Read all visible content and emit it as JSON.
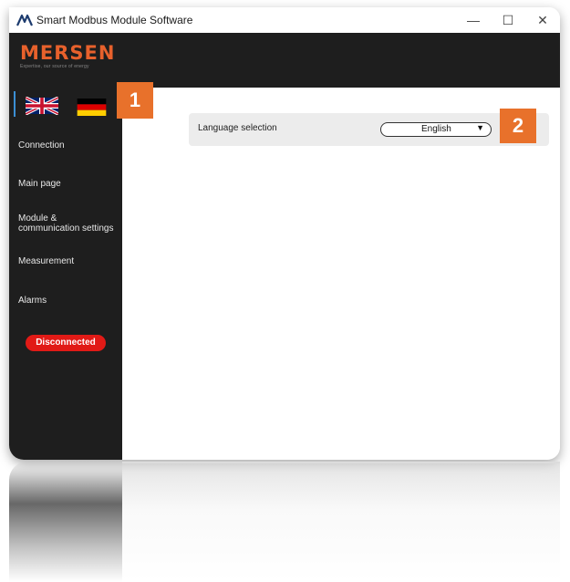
{
  "window": {
    "title": "Smart Modbus Module Software",
    "controls": {
      "minimize": "—",
      "maximize": "☐",
      "close": "✕"
    }
  },
  "brand": {
    "name": "MERSEN",
    "tagline": "Expertise, our source of energy",
    "color": "#e8612c"
  },
  "sidebar": {
    "languages": [
      "English (UK flag)",
      "German (DE flag)"
    ],
    "items": [
      {
        "label": "Connection"
      },
      {
        "label": "Main page"
      },
      {
        "label": "Module & communication settings"
      },
      {
        "label": "Measurement"
      },
      {
        "label": "Alarms"
      }
    ],
    "status": {
      "label": "Disconnected",
      "color": "#e11a16"
    }
  },
  "main": {
    "language_selection": {
      "label": "Language selection",
      "selected": "English"
    }
  },
  "annotations": [
    {
      "label": "1",
      "color": "#e8712b"
    },
    {
      "label": "2",
      "color": "#e8712b"
    }
  ]
}
